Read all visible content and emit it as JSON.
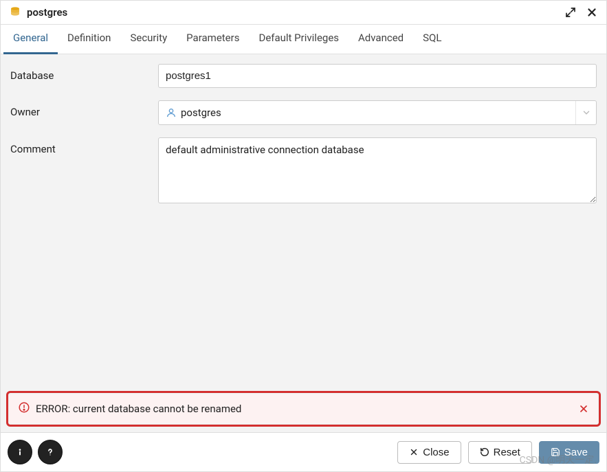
{
  "dialog": {
    "title": "postgres"
  },
  "tabs": [
    {
      "label": "General",
      "active": true
    },
    {
      "label": "Definition",
      "active": false
    },
    {
      "label": "Security",
      "active": false
    },
    {
      "label": "Parameters",
      "active": false
    },
    {
      "label": "Default Privileges",
      "active": false
    },
    {
      "label": "Advanced",
      "active": false
    },
    {
      "label": "SQL",
      "active": false
    }
  ],
  "form": {
    "database_label": "Database",
    "database_value": "postgres1",
    "owner_label": "Owner",
    "owner_value": "postgres",
    "comment_label": "Comment",
    "comment_value": "default administrative connection database"
  },
  "alert": {
    "message": "ERROR: current database cannot be renamed"
  },
  "footer": {
    "close_label": "Close",
    "reset_label": "Reset",
    "save_label": "Save"
  },
  "watermark": "CSDN @明天一定."
}
